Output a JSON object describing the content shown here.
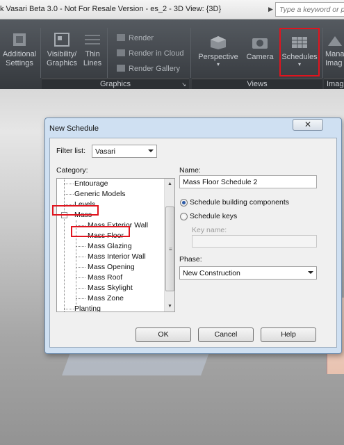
{
  "titlebar": {
    "title": "k Vasari Beta 3.0 - Not For Resale Version -    es_2 - 3D View: {3D}",
    "search_placeholder": "Type a keyword or phr"
  },
  "ribbon": {
    "buttons": {
      "additional_settings": "Additional\nSettings",
      "visibility_graphics": "Visibility/\nGraphics",
      "thin_lines": "Thin\nLines",
      "perspective": "Perspective",
      "camera": "Camera",
      "schedules": "Schedules",
      "manage_images": "Manag\nImag"
    },
    "render_items": [
      "Render",
      "Render in Cloud",
      "Render Gallery"
    ],
    "panels": {
      "graphics": "Graphics",
      "views": "Views",
      "images": "Imag"
    },
    "highlight_color": "#e0141e"
  },
  "dialog": {
    "title": "New Schedule",
    "close_glyph": "✕",
    "filter_label": "Filter list:",
    "filter_value": "Vasari",
    "category_label": "Category:",
    "tree": [
      {
        "label": "Entourage",
        "level": 0
      },
      {
        "label": "Generic Models",
        "level": 0
      },
      {
        "label": "Levels",
        "level": 0
      },
      {
        "label": "Mass",
        "level": 0,
        "expanded": true
      },
      {
        "label": "Mass Exterior Wall",
        "level": 1
      },
      {
        "label": "Mass Floor",
        "level": 1,
        "selected": true
      },
      {
        "label": "Mass Glazing",
        "level": 1
      },
      {
        "label": "Mass Interior Wall",
        "level": 1
      },
      {
        "label": "Mass Opening",
        "level": 1
      },
      {
        "label": "Mass Roof",
        "level": 1
      },
      {
        "label": "Mass Skylight",
        "level": 1
      },
      {
        "label": "Mass Zone",
        "level": 1
      },
      {
        "label": "Planting",
        "level": 0
      }
    ],
    "name_label": "Name:",
    "name_value": "Mass Floor Schedule 2",
    "radio_building": "Schedule building components",
    "radio_keys": "Schedule keys",
    "key_name_label": "Key name:",
    "key_name_value": "",
    "phase_label": "Phase:",
    "phase_value": "New Construction",
    "ok": "OK",
    "cancel": "Cancel",
    "help": "Help"
  }
}
